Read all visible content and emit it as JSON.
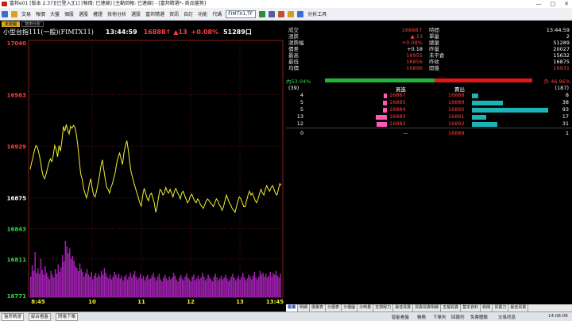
{
  "window": {
    "title": "富邦e01 [版本 2.37][已登入][1] [報價: 已連線] [主動回報: 已連線] - [富邦精選*- 商品盤勢]",
    "controls": [
      "—",
      "□",
      "✕"
    ]
  },
  "menu": {
    "items": [
      "交易",
      "報價",
      "大盤",
      "個股",
      "選股",
      "權證",
      "技術分析",
      "選股",
      "富邦精選",
      "資訊",
      "自訂",
      "功能"
    ],
    "search_label": "代碼",
    "symbol_value": "FIMTX1.TF",
    "analysis_label": "分析工具"
  },
  "subtabs": [
    "走勢圖",
    "技術分析"
  ],
  "chart_header": {
    "name": "小型台指111(一般)(FIMTX11)",
    "time": "13:44:59",
    "price": "16888",
    "arrow": "↑",
    "change": "▲13",
    "pct": "+0.08%",
    "volume": "51289口"
  },
  "chart_data": {
    "type": "line",
    "x_ticks": [
      "8:45",
      "10",
      "11",
      "12",
      "13",
      "13:45"
    ],
    "y_ticks": [
      {
        "label": "17040",
        "value": 17040,
        "color": "#ff3c3c"
      },
      {
        "label": "16983",
        "value": 16983,
        "color": "#ff3c3c"
      },
      {
        "label": "16929",
        "value": 16929,
        "color": "#ff3c3c"
      },
      {
        "label": "16875",
        "value": 16875,
        "color": "#ffffff"
      },
      {
        "label": "16843",
        "value": 16843,
        "color": "#3ad04a"
      },
      {
        "label": "16811",
        "value": 16811,
        "color": "#3ad04a"
      },
      {
        "label": "16771",
        "value": 16771,
        "color": "#3ad04a"
      }
    ],
    "ylim": [
      16771,
      17040
    ],
    "series": [
      {
        "values": [
          16905,
          16912,
          16918,
          16925,
          16930,
          16928,
          16922,
          16915,
          16905,
          16898,
          16895,
          16900,
          16906,
          16912,
          16916,
          16913,
          16920,
          16930,
          16926,
          16918,
          16930,
          16924,
          16935,
          16950,
          16945,
          16952,
          16946,
          16942,
          16950,
          16948,
          16951,
          16949,
          16942,
          16930,
          16915,
          16900,
          16895,
          16885,
          16880,
          16875,
          16880,
          16890,
          16895,
          16885,
          16878,
          16876,
          16882,
          16890,
          16898,
          16908,
          16915,
          16905,
          16895,
          16886,
          16884,
          16880,
          16886,
          16890,
          16896,
          16902,
          16912,
          16918,
          16922,
          16916,
          16910,
          16922,
          16930,
          16935,
          16925,
          16912,
          16902,
          16896,
          16890,
          16885,
          16880,
          16875,
          16870,
          16866,
          16878,
          16885,
          16880,
          16875,
          16872,
          16878,
          16880,
          16875,
          16870,
          16860,
          16866,
          16876,
          16884,
          16882,
          16878,
          16880,
          16886,
          16882,
          16880,
          16884,
          16880,
          16876,
          16882,
          16885,
          16881,
          16878,
          16874,
          16880,
          16882,
          16878,
          16874,
          16870,
          16872,
          16877,
          16879,
          16875,
          16872,
          16870,
          16874,
          16872,
          16868,
          16866,
          16864,
          16868,
          16872,
          16874,
          16872,
          16870,
          16868,
          16866,
          16870,
          16874,
          16872,
          16868,
          16866,
          16862,
          16866,
          16872,
          16878,
          16874,
          16870,
          16868,
          16864,
          16862,
          16860,
          16866,
          16872,
          16876,
          16874,
          16870,
          16866,
          16866,
          16872,
          16878,
          16882,
          16878,
          16880,
          16876,
          16872,
          16870,
          16874,
          16880,
          16884,
          16880,
          16878,
          16884,
          16888,
          16884,
          16882,
          16886,
          16888,
          16884,
          16880,
          16878,
          16884,
          16890,
          16888
        ]
      }
    ],
    "volume": [
      22,
      34,
      28,
      48,
      26,
      31,
      25,
      41,
      29,
      24,
      33,
      26,
      22,
      19,
      28,
      24,
      21,
      30,
      25,
      35,
      27,
      32,
      45,
      38,
      60,
      54,
      47,
      52,
      41,
      44,
      39,
      33,
      31,
      28,
      36,
      30,
      27,
      22,
      26,
      30,
      24,
      22,
      27,
      19,
      23,
      26,
      21,
      25,
      22,
      28,
      24,
      31,
      26,
      22,
      20,
      24,
      19,
      22,
      27,
      24,
      21,
      25,
      20,
      23,
      18,
      22,
      24,
      19,
      22,
      26,
      21,
      24,
      28,
      22,
      19,
      21,
      25,
      20,
      23,
      18,
      22,
      24,
      19,
      20,
      23,
      26,
      21,
      18,
      22,
      25,
      19,
      17,
      21,
      24,
      20,
      18,
      22,
      19,
      21,
      26,
      23,
      19,
      17,
      21,
      24,
      20,
      18,
      22,
      25,
      21,
      19,
      17,
      22,
      24,
      18,
      20,
      23,
      19,
      21,
      26,
      22,
      18,
      20,
      24,
      21,
      19,
      17,
      22,
      25,
      21,
      18,
      20,
      23,
      19,
      21,
      24,
      20,
      17,
      19,
      22,
      25,
      21,
      18,
      20,
      23,
      19,
      22,
      26,
      21,
      18,
      20,
      24,
      22,
      19,
      23,
      27,
      21,
      19,
      22,
      28,
      24,
      26,
      22,
      25,
      21,
      23,
      27,
      22,
      26,
      24,
      28,
      23,
      21,
      25
    ],
    "grid": true
  },
  "quote": {
    "rows": [
      {
        "l1": "成交",
        "v1": "16888↑",
        "c1": "red",
        "l2": "時間",
        "v2": "13:44:59",
        "c2": "white"
      },
      {
        "l1": "漲跌",
        "v1": "▲ 13",
        "c1": "red",
        "l2": "單量",
        "v2": "2",
        "c2": "white"
      },
      {
        "l1": "漲跌幅",
        "v1": "+0.08%",
        "c1": "red",
        "l2": "總量",
        "v2": "51289",
        "c2": "white"
      },
      {
        "l1": "價差",
        "v1": "+0.18",
        "c1": "white",
        "l2": "昨量",
        "v2": "20027",
        "c2": "white"
      },
      {
        "l1": "最高",
        "v1": "16955",
        "c1": "red",
        "l2": "未平倉",
        "v2": "15632",
        "c2": "white"
      },
      {
        "l1": "最低",
        "v1": "16856",
        "c1": "red",
        "l2": "昨收",
        "v2": "16875",
        "c2": "white"
      },
      {
        "l1": "均價",
        "v1": "16896",
        "c1": "red",
        "l2": "開盤",
        "v2": "16931",
        "c2": "red"
      }
    ],
    "inner_ratio": "內53.04%",
    "outer_ratio": "外 46.96%",
    "inner_fraction": 0.5304
  },
  "orderbook": {
    "bid_total": "(39)",
    "bid_header": "買進",
    "ask_header": "賣出",
    "ask_total": "(187)",
    "rows": [
      {
        "bid_size": "4",
        "bid_price": "16887",
        "ask_price": "16888",
        "ask_size": "8",
        "bid_n": 4,
        "ask_n": 8
      },
      {
        "bid_size": "5",
        "bid_price": "16885",
        "ask_price": "16889",
        "ask_size": "38",
        "bid_n": 5,
        "ask_n": 38
      },
      {
        "bid_size": "5",
        "bid_price": "16884",
        "ask_price": "16890",
        "ask_size": "93",
        "bid_n": 5,
        "ask_n": 93
      },
      {
        "bid_size": "13",
        "bid_price": "16883",
        "ask_price": "16891",
        "ask_size": "17",
        "bid_n": 13,
        "ask_n": 17
      },
      {
        "bid_size": "12",
        "bid_price": "16882",
        "ask_price": "16892",
        "ask_size": "31",
        "bid_n": 12,
        "ask_n": 31
      }
    ],
    "footer": {
      "left": "0",
      "mid": "--",
      "price": "16889",
      "right": "1"
    }
  },
  "right_tabs": [
    "報價",
    "明細",
    "價量表",
    "分價表",
    "分價圖",
    "分時量",
    "支撐壓力",
    "最佳買賣",
    "買賣買賣明細",
    "五檔買賣",
    "基本資料",
    "新聞",
    "買賣力",
    "最佳買賣"
  ],
  "statusbar": {
    "tabs": [
      "盤房精選",
      "綜合看盤",
      "閃電下單"
    ],
    "right_items": [
      "智能看盤",
      "帳務",
      "下單夾",
      "回報列",
      "免費體驗",
      "交易訊息",
      "14:08:08"
    ]
  },
  "colors": {
    "up": "#ff3c3c",
    "down": "#3ad04a",
    "price_line": "#f0f030",
    "volume": "#a020b0",
    "grid": "#8a1c1c",
    "bid_bar": "#ff5ab4",
    "ask_bar": "#1cb4b4"
  }
}
